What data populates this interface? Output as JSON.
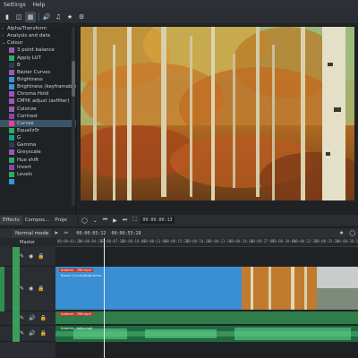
{
  "menubar": {
    "items": [
      "Settings",
      "Help"
    ]
  },
  "toolbar": {
    "icons": [
      "layout-single-icon",
      "layout-split-icon",
      "layout-grid-icon",
      "speaker-icon",
      "music-icon",
      "star-icon",
      "settings-icon"
    ]
  },
  "effects": {
    "categories": [
      {
        "label": "Alpha/Transform",
        "expanded": false
      },
      {
        "label": "Analysis and data",
        "expanded": false
      },
      {
        "label": "Colour",
        "expanded": true
      }
    ],
    "items": [
      {
        "label": "3 point balance",
        "color": "#9b59b6"
      },
      {
        "label": "Apply LUT",
        "color": "#27ae60"
      },
      {
        "label": "B",
        "color": "#2c3e50"
      },
      {
        "label": "Bézier Curves",
        "color": "#9b59b6"
      },
      {
        "label": "Brightness",
        "color": "#3498db"
      },
      {
        "label": "Brightness (keyframable)",
        "color": "#3498db"
      },
      {
        "label": "Chroma Hold",
        "color": "#9b59b6"
      },
      {
        "label": "CMYK adjust (avfilter)",
        "color": "#9b59b6"
      },
      {
        "label": "Colorize",
        "color": "#9b59b6"
      },
      {
        "label": "Contrast",
        "color": "#8e44ad"
      },
      {
        "label": "Curves",
        "color": "#e84393"
      },
      {
        "label": "Equaliz0r",
        "color": "#27ae60"
      },
      {
        "label": "G",
        "color": "#16a085"
      },
      {
        "label": "Gamma",
        "color": "#2c3e50"
      },
      {
        "label": "Greyscale",
        "color": "#9b59b6"
      },
      {
        "label": "Hue shift",
        "color": "#27ae60"
      },
      {
        "label": "Invert",
        "color": "#8e44ad"
      },
      {
        "label": "Levels",
        "color": "#27ae60"
      },
      {
        "label": "",
        "color": "#3498db"
      }
    ],
    "selected_index": 10
  },
  "tabs": [
    "Effects",
    "Compos...",
    "Proje"
  ],
  "monitor_controls": {
    "timecode": "00:00:00:13"
  },
  "timeline": {
    "mode": "Normal mode",
    "tc_position": "00:00:05:12",
    "tc_duration": "00:00:55:28",
    "master_label": "Master",
    "ruler_ticks": [
      "00:00:01:22",
      "00:00:04:17",
      "00:00:07:12",
      "00:00:10:07",
      "00:00:13:02",
      "00:00:15:27",
      "00:00:18:22",
      "00:00:21:17",
      "00:00:24:12",
      "00:00:27:07",
      "00:00:30:02",
      "00:00:32:27",
      "00:00:35:22",
      "00:00:38:17"
    ],
    "clips": {
      "v1_label": "Autumn - 766.mp4",
      "v1_sublabel": "Bezier Curves/Brightness",
      "a1_label": "Autumn - 766.mp4",
      "a2_label": "Autumn - bells.mp4"
    }
  },
  "colors": {
    "accent": "#3b5468",
    "clip_blue": "#3a8ed4",
    "audio_green": "#2e9f5a",
    "clip_label_red": "#c0392b"
  }
}
